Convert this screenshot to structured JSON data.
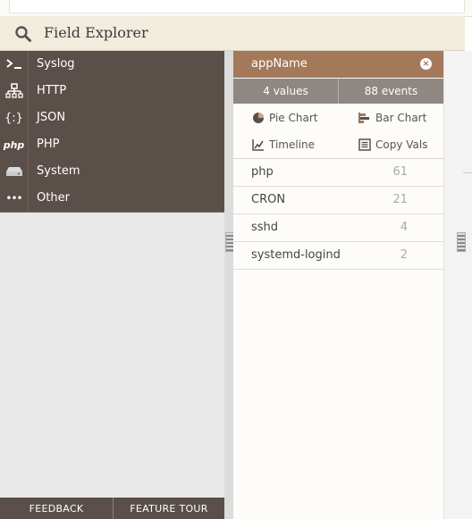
{
  "header": {
    "title": "Field Explorer"
  },
  "categories": [
    {
      "icon": "terminal-icon",
      "label": "Syslog"
    },
    {
      "icon": "sitemap-icon",
      "label": "HTTP"
    },
    {
      "icon": "braces-icon",
      "label": "JSON"
    },
    {
      "icon": "php-icon",
      "label": "PHP"
    },
    {
      "icon": "server-icon",
      "label": "System"
    },
    {
      "icon": "ellipsis-icon",
      "label": "Other"
    }
  ],
  "icon_glyphs": {
    "braces": "{:}",
    "php": "php",
    "ellipsis": "•••"
  },
  "footer": {
    "feedback": "FEEDBACK",
    "feature_tour": "FEATURE TOUR"
  },
  "field": {
    "name": "appName",
    "values_count": "4 values",
    "events_count": "88 events",
    "actions": {
      "pie_chart": "Pie Chart",
      "bar_chart": "Bar Chart",
      "timeline": "Timeline",
      "copy_vals": "Copy Vals"
    },
    "values": [
      {
        "value": "php",
        "count": "61"
      },
      {
        "value": "CRON",
        "count": "21"
      },
      {
        "value": "sshd",
        "count": "4"
      },
      {
        "value": "systemd-logind",
        "count": "2"
      }
    ]
  },
  "colors": {
    "category_bg": "#5a4f49",
    "field_header_bg": "#a3795a",
    "stats_bg": "#8e8782",
    "header_bg": "#f1ecdc"
  }
}
